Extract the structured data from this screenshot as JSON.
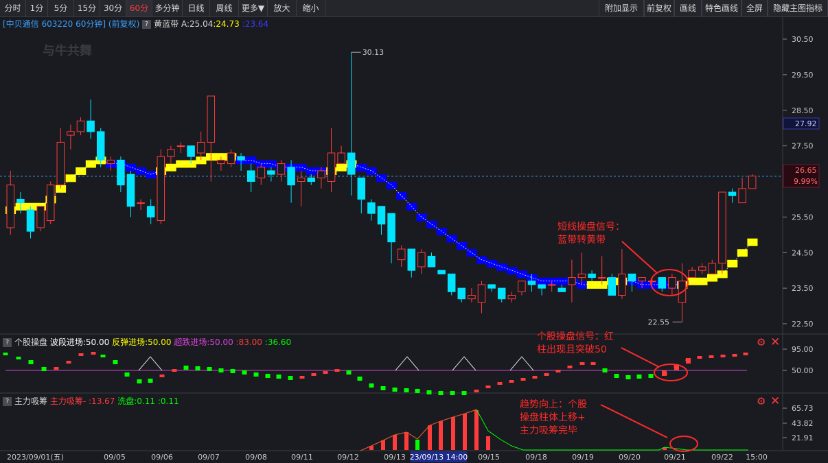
{
  "toolbar": {
    "left": [
      "分时",
      "1分",
      "5分",
      "15分",
      "30分",
      "60分",
      "多分钟",
      "日线",
      "周线",
      "更多▼",
      "放大",
      "缩小"
    ],
    "active": "60分",
    "right": [
      "附加显示",
      "前复权",
      "画线",
      "特色画线",
      "全屏",
      "隐藏主图指标"
    ]
  },
  "main_info": {
    "stock": "[中贝通信 603220 60分钟]",
    "adj": "(前复权)",
    "q": "?",
    "indicator": "黄蓝带",
    "a_label": "A:25.04",
    "v1": ":24.73",
    "v2": ":23.64"
  },
  "price_axis": {
    "ticks": [
      "30.50",
      "29.50",
      "28.50",
      "27.50",
      "25.50",
      "24.50",
      "23.50",
      "22.50"
    ],
    "box_blue": "27.92",
    "box_red_price": "26.65",
    "box_red_pct": "9.99%"
  },
  "markers": {
    "high": "30.13",
    "low": "22.55"
  },
  "pane2": {
    "q": "?",
    "name": "个股操盘",
    "a": "波段进场:50.00",
    "b": "反弹进场:50.00",
    "c": "超跌进场:50.00",
    "d": ":83.00",
    "e": ":36.60",
    "ticks": [
      "95.00",
      "50.00"
    ]
  },
  "pane3": {
    "q": "?",
    "name": "主力吸筹",
    "a": "主力吸筹-",
    "b": ":13.67",
    "c": "洗盘:0.11",
    "d": ":0.11",
    "ticks": [
      "65.73",
      "43.82",
      "21.91"
    ]
  },
  "xaxis": {
    "labels": [
      "2023/09/01(五)",
      "09/05",
      "09/06",
      "09/07",
      "09/08",
      "09/11",
      "09/12",
      "09/13",
      "23/09/13 14:00",
      "09/15",
      "09/18",
      "09/19",
      "09/20",
      "09/21",
      "09/22",
      "15:00"
    ]
  },
  "annotations": {
    "a1": [
      "短线操盘信号：",
      "蓝带转黄带"
    ],
    "a2": [
      "个股操盘信号：红",
      "柱出现且突破50"
    ],
    "a3": [
      "趋势向上：个股",
      "操盘柱体上移+",
      "主力吸筹完毕"
    ]
  },
  "colors": {
    "up": "#ff3b3b",
    "down": "#00e5ff",
    "yellow": "#ffff00",
    "blue": "#0000ff",
    "green": "#00ff00",
    "magenta": "#cc44cc"
  },
  "chart_data": {
    "type": "candlestick",
    "ylim": [
      22.2,
      31.0
    ],
    "ticks": [
      30.5,
      29.5,
      28.5,
      27.5,
      25.5,
      24.5,
      23.5,
      22.5
    ],
    "candles": [
      [
        25.2,
        26.4,
        25.0,
        26.8
      ],
      [
        26.0,
        25.9,
        25.6,
        26.2
      ],
      [
        25.7,
        25.1,
        24.9,
        25.8
      ],
      [
        25.2,
        25.8,
        25.1,
        25.8
      ],
      [
        25.4,
        26.4,
        25.3,
        26.5
      ],
      [
        26.4,
        27.6,
        26.3,
        28.0
      ],
      [
        27.8,
        27.9,
        27.4,
        28.1
      ],
      [
        27.9,
        28.2,
        27.8,
        28.3
      ],
      [
        28.2,
        27.9,
        27.7,
        28.8
      ],
      [
        27.9,
        27.1,
        26.9,
        28.0
      ],
      [
        27.0,
        27.1,
        26.8,
        27.2
      ],
      [
        27.1,
        26.4,
        26.2,
        27.2
      ],
      [
        26.7,
        25.8,
        25.5,
        26.8
      ],
      [
        25.9,
        25.9,
        25.7,
        26.0
      ],
      [
        25.8,
        25.5,
        25.3,
        26.0
      ],
      [
        25.4,
        27.2,
        25.3,
        27.4
      ],
      [
        27.2,
        27.4,
        27.0,
        27.5
      ],
      [
        27.5,
        27.5,
        27.3,
        27.6
      ],
      [
        27.5,
        27.2,
        27.0,
        27.5
      ],
      [
        27.3,
        27.6,
        27.1,
        27.9
      ],
      [
        27.6,
        28.9,
        26.5,
        28.9
      ],
      [
        27.0,
        27.1,
        26.8,
        27.2
      ],
      [
        27.0,
        27.3,
        26.9,
        27.4
      ],
      [
        27.2,
        27.1,
        26.8,
        27.3
      ],
      [
        26.8,
        26.5,
        26.2,
        27.0
      ],
      [
        26.6,
        26.9,
        26.4,
        27.0
      ],
      [
        26.8,
        26.7,
        26.5,
        26.9
      ],
      [
        26.7,
        27.0,
        26.5,
        27.1
      ],
      [
        26.9,
        26.4,
        25.9,
        27.1
      ],
      [
        26.5,
        26.6,
        25.8,
        26.8
      ],
      [
        26.6,
        26.5,
        26.4,
        26.7
      ],
      [
        26.6,
        26.8,
        26.3,
        26.9
      ],
      [
        26.5,
        27.3,
        26.2,
        28.0
      ],
      [
        27.0,
        27.3,
        27.0,
        27.5
      ],
      [
        27.3,
        26.7,
        26.1,
        30.13
      ],
      [
        26.6,
        26.0,
        25.6,
        26.6
      ],
      [
        25.9,
        25.6,
        25.4,
        26.0
      ],
      [
        25.8,
        25.3,
        25.0,
        25.8
      ],
      [
        25.6,
        24.8,
        24.2,
        25.6
      ],
      [
        24.3,
        24.6,
        24.1,
        24.7
      ],
      [
        24.6,
        24.0,
        23.8,
        24.6
      ],
      [
        24.1,
        24.5,
        23.9,
        24.6
      ],
      [
        24.4,
        24.1,
        24.1,
        24.5
      ],
      [
        24.0,
        23.9,
        23.9,
        24.0
      ],
      [
        23.9,
        23.4,
        23.3,
        23.9
      ],
      [
        23.5,
        23.2,
        23.1,
        23.5
      ],
      [
        23.2,
        23.3,
        23.1,
        23.5
      ],
      [
        23.1,
        23.6,
        22.8,
        23.7
      ],
      [
        23.6,
        23.5,
        23.4,
        23.6
      ],
      [
        23.5,
        23.2,
        23.1,
        23.5
      ],
      [
        23.2,
        23.3,
        23.1,
        23.4
      ],
      [
        23.4,
        23.7,
        23.3,
        23.7
      ],
      [
        23.7,
        23.6,
        23.4,
        23.9
      ],
      [
        23.6,
        23.5,
        23.3,
        23.6
      ],
      [
        23.6,
        23.6,
        23.4,
        23.7
      ],
      [
        23.5,
        23.4,
        23.4,
        23.6
      ],
      [
        23.6,
        23.8,
        23.1,
        24.3
      ],
      [
        23.8,
        23.9,
        23.6,
        24.5
      ],
      [
        23.9,
        23.8,
        23.7,
        24.0
      ],
      [
        23.8,
        23.8,
        23.6,
        24.4
      ],
      [
        23.8,
        23.3,
        23.3,
        23.9
      ],
      [
        23.3,
        23.9,
        23.2,
        24.6
      ],
      [
        23.9,
        23.7,
        23.4,
        23.9
      ],
      [
        23.7,
        23.8,
        23.5,
        23.8
      ],
      [
        23.7,
        23.7,
        23.6,
        23.8
      ],
      [
        23.8,
        23.5,
        23.4,
        23.8
      ],
      [
        23.5,
        23.8,
        23.3,
        23.9
      ],
      [
        23.1,
        23.7,
        22.55,
        24.2
      ],
      [
        23.8,
        24.0,
        23.8,
        24.1
      ],
      [
        24.0,
        24.1,
        23.9,
        24.2
      ],
      [
        23.9,
        24.2,
        23.9,
        24.3
      ],
      [
        24.2,
        26.2,
        23.9,
        26.2
      ],
      [
        26.2,
        26.1,
        25.9,
        26.3
      ],
      [
        25.9,
        26.3,
        25.9,
        26.6
      ],
      [
        26.3,
        26.65,
        26.3,
        26.7
      ]
    ],
    "band": [
      [
        25.7,
        "y"
      ],
      [
        25.8,
        "y"
      ],
      [
        25.8,
        "y"
      ],
      [
        25.8,
        "y"
      ],
      [
        26.0,
        "y"
      ],
      [
        26.3,
        "y"
      ],
      [
        26.6,
        "y"
      ],
      [
        26.8,
        "y"
      ],
      [
        27.0,
        "y"
      ],
      [
        27.1,
        "y"
      ],
      [
        27.0,
        "b"
      ],
      [
        27.0,
        "b"
      ],
      [
        26.9,
        "b"
      ],
      [
        26.8,
        "b"
      ],
      [
        26.7,
        "b"
      ],
      [
        26.8,
        "y"
      ],
      [
        26.9,
        "y"
      ],
      [
        27.0,
        "y"
      ],
      [
        27.0,
        "y"
      ],
      [
        27.1,
        "y"
      ],
      [
        27.2,
        "y"
      ],
      [
        27.2,
        "y"
      ],
      [
        27.2,
        "y"
      ],
      [
        27.1,
        "b"
      ],
      [
        27.1,
        "b"
      ],
      [
        27.0,
        "b"
      ],
      [
        27.0,
        "b"
      ],
      [
        26.9,
        "b"
      ],
      [
        26.9,
        "b"
      ],
      [
        26.9,
        "b"
      ],
      [
        26.8,
        "b"
      ],
      [
        26.8,
        "b"
      ],
      [
        26.8,
        "y"
      ],
      [
        26.9,
        "y"
      ],
      [
        27.0,
        "y"
      ],
      [
        26.9,
        "b"
      ],
      [
        26.8,
        "b"
      ],
      [
        26.6,
        "b"
      ],
      [
        26.4,
        "b"
      ],
      [
        26.1,
        "b"
      ],
      [
        25.8,
        "b"
      ],
      [
        25.5,
        "b"
      ],
      [
        25.3,
        "b"
      ],
      [
        25.1,
        "b"
      ],
      [
        24.9,
        "b"
      ],
      [
        24.7,
        "b"
      ],
      [
        24.5,
        "b"
      ],
      [
        24.3,
        "b"
      ],
      [
        24.2,
        "b"
      ],
      [
        24.1,
        "b"
      ],
      [
        24.0,
        "b"
      ],
      [
        23.9,
        "b"
      ],
      [
        23.8,
        "b"
      ],
      [
        23.7,
        "b"
      ],
      [
        23.7,
        "b"
      ],
      [
        23.7,
        "b"
      ],
      [
        23.7,
        "b"
      ],
      [
        23.6,
        "b"
      ],
      [
        23.6,
        "y"
      ],
      [
        23.6,
        "y"
      ],
      [
        23.7,
        "y"
      ],
      [
        23.7,
        "y"
      ],
      [
        23.7,
        "b"
      ],
      [
        23.6,
        "b"
      ],
      [
        23.6,
        "b"
      ],
      [
        23.6,
        "b"
      ],
      [
        23.6,
        "b"
      ],
      [
        23.6,
        "y"
      ],
      [
        23.7,
        "y"
      ],
      [
        23.7,
        "y"
      ],
      [
        23.8,
        "y"
      ],
      [
        23.9,
        "y"
      ],
      [
        24.2,
        "y"
      ],
      [
        24.5,
        "y"
      ],
      [
        24.8,
        "y"
      ]
    ]
  }
}
